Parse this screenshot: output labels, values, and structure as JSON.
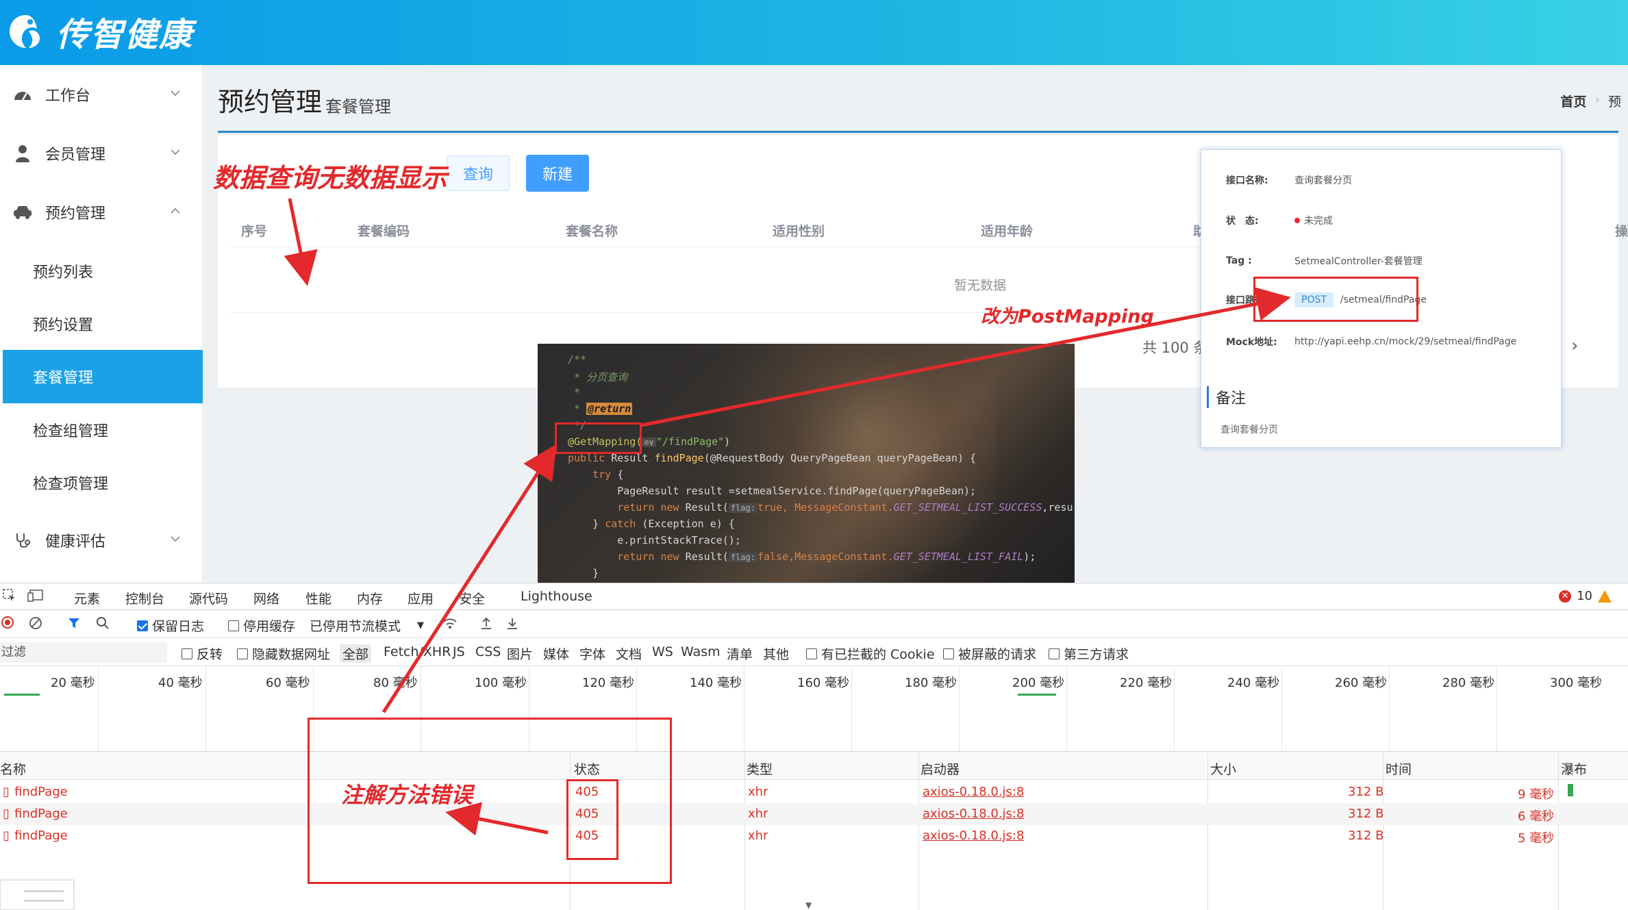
{
  "app": {
    "logo_text": "传智健康"
  },
  "sidebar": {
    "items": [
      {
        "label": "工作台",
        "icon": "dashboard-icon"
      },
      {
        "label": "会员管理",
        "icon": "user-icon"
      },
      {
        "label": "预约管理",
        "icon": "car-icon"
      },
      {
        "label": "预约列表"
      },
      {
        "label": "预约设置"
      },
      {
        "label": "套餐管理"
      },
      {
        "label": "检查组管理"
      },
      {
        "label": "检查项管理"
      },
      {
        "label": "健康评估",
        "icon": "stethoscope-icon"
      }
    ]
  },
  "page": {
    "title": "预约管理",
    "subtitle": "套餐管理",
    "breadcrumb_home": "首页",
    "breadcrumb_next": "预",
    "query_button": "查询",
    "new_button": "新建",
    "columns": [
      "序号",
      "套餐编码",
      "套餐名称",
      "适用性别",
      "适用年龄",
      "助",
      "操"
    ],
    "empty_text": "暂无数据",
    "total_text": "共 100 条",
    "pager_next": "›"
  },
  "annotations": {
    "no_data": "数据查询无数据显示",
    "change_post": "改为PostMapping",
    "wrong_method": "注解方法错误"
  },
  "api_doc": {
    "name_label": "接口名称:",
    "name_value": "查询套餐分页",
    "status_label": "状　态:",
    "status_value": "未完成",
    "tag_label": "Tag :",
    "tag_value": "SetmealController-套餐管理",
    "path_label": "接口路径:",
    "method": "POST",
    "path_value": "/setmeal/findPage",
    "mock_label": "Mock地址:",
    "mock_value": "http://yapi.eehp.cn/mock/29/setmeal/findPage",
    "note_title": "备注",
    "note_value": "查询套餐分页"
  },
  "code": {
    "l1": "/**",
    "l2": " * 分页查询",
    "l3": " *",
    "l4_pre": " * ",
    "l4_tag": "@return",
    "l5": " */",
    "l6_ann": "@GetMapping(",
    "l6_str": "\"/findPage\"",
    "l6_end": ")",
    "l7_kw": "public",
    "l7_a": " Result ",
    "l7_fn": "findPage",
    "l7_b": "(@RequestBody QueryPageBean queryPageBean) {",
    "l8_kw": "    try",
    "l8_b": " {",
    "l9": "        PageResult result =setmealService.findPage(queryPageBean);",
    "l10_kw": "        return new",
    "l10_a": " Result(",
    "l10_hint": "flag:",
    "l10_b": "true, MessageConstant.",
    "l10_fld": "GET_SETMEAL_LIST_SUCCESS",
    "l10_c": ",resu",
    "l11_a": "    } ",
    "l11_kw": "catch",
    "l11_b": " (Exception e) {",
    "l12": "        e.printStackTrace();",
    "l13_kw": "        return new",
    "l13_a": " Result(",
    "l13_hint": "flag:",
    "l13_b": "false,MessageConstant.",
    "l13_fld": "GET_SETMEAL_LIST_FAIL",
    "l13_c": ");",
    "l14": "    }"
  },
  "devtools": {
    "tabs": [
      "元素",
      "控制台",
      "源代码",
      "网络",
      "性能",
      "内存",
      "应用",
      "安全",
      "Lighthouse"
    ],
    "error_count": "10",
    "preserve_log": "保留日志",
    "disable_cache": "停用缓存",
    "throttle": "已停用节流模式",
    "filter_placeholder": "过滤",
    "invert": "反转",
    "hide_data_urls": "隐藏数据网址",
    "types": [
      "全部",
      "Fetch/XHR",
      "JS",
      "CSS",
      "图片",
      "媒体",
      "字体",
      "文档",
      "WS",
      "Wasm",
      "清单",
      "其他"
    ],
    "blocked_cookies": "有已拦截的 Cookie",
    "blocked_requests": "被屏蔽的请求",
    "third_party": "第三方请求",
    "timeline_ticks": [
      "20 毫秒",
      "40 毫秒",
      "60 毫秒",
      "80 毫秒",
      "100 毫秒",
      "120 毫秒",
      "140 毫秒",
      "160 毫秒",
      "180 毫秒",
      "200 毫秒",
      "220 毫秒",
      "240 毫秒",
      "260 毫秒",
      "280 毫秒",
      "300 毫秒"
    ],
    "columns": {
      "name": "名称",
      "status": "状态",
      "type": "类型",
      "initiator": "启动器",
      "size": "大小",
      "time": "时间",
      "waterfall": "瀑布"
    },
    "rows": [
      {
        "name": "findPage",
        "status": "405",
        "type": "xhr",
        "initiator": "axios-0.18.0.js:8",
        "size": "312 B",
        "time": "9 毫秒"
      },
      {
        "name": "findPage",
        "status": "405",
        "type": "xhr",
        "initiator": "axios-0.18.0.js:8",
        "size": "312 B",
        "time": "6 毫秒"
      },
      {
        "name": "findPage",
        "status": "405",
        "type": "xhr",
        "initiator": "axios-0.18.0.js:8",
        "size": "312 B",
        "time": "5 毫秒"
      }
    ]
  },
  "colors": {
    "accent": "#1aa1e6",
    "annotation": "#e3292b",
    "error_red": "#d93025"
  }
}
